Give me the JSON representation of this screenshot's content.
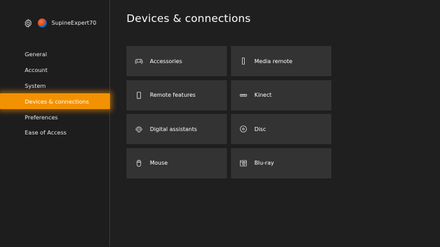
{
  "profile": {
    "settings_icon": "gear-icon",
    "username": "SupineExpert70"
  },
  "sidebar": {
    "items": [
      {
        "label": "General"
      },
      {
        "label": "Account"
      },
      {
        "label": "System"
      },
      {
        "label": "Devices & connections",
        "selected": true
      },
      {
        "label": "Preferences"
      },
      {
        "label": "Ease of Access"
      }
    ],
    "selected_color": "#f39200"
  },
  "page": {
    "title": "Devices & connections"
  },
  "tiles": [
    {
      "label": "Accessories",
      "icon": "controller-icon"
    },
    {
      "label": "Media remote",
      "icon": "media-remote-icon"
    },
    {
      "label": "Remote features",
      "icon": "phone-icon"
    },
    {
      "label": "Kinect",
      "icon": "kinect-icon"
    },
    {
      "label": "Digital assistants",
      "icon": "assistant-icon"
    },
    {
      "label": "Disc",
      "icon": "disc-icon"
    },
    {
      "label": "Mouse",
      "icon": "mouse-icon"
    },
    {
      "label": "Blu-ray",
      "icon": "bluray-icon"
    }
  ]
}
